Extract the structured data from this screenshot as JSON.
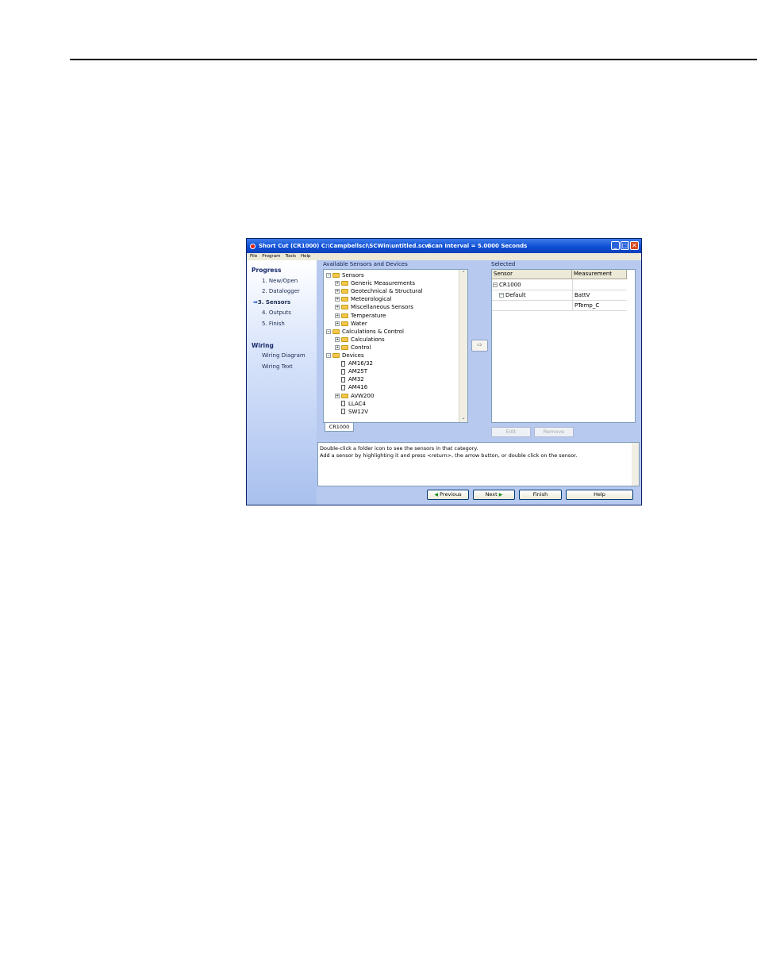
{
  "window": {
    "title": "Short Cut (CR1000) C:\\Campbellsci\\SCWin\\untitled.scw",
    "scan_interval": "Scan Interval = 5.0000 Seconds",
    "menu": [
      "File",
      "Program",
      "Tools",
      "Help"
    ]
  },
  "sidebar": {
    "progress_heading": "Progress",
    "steps": [
      "1. New/Open",
      "2. Datalogger",
      "3. Sensors",
      "4. Outputs",
      "5. Finish"
    ],
    "active_step": "3. Sensors",
    "wiring_heading": "Wiring",
    "wiring_items": [
      "Wiring Diagram",
      "Wiring Text"
    ]
  },
  "available": {
    "label": "Available Sensors and Devices",
    "tree": [
      {
        "label": "Sensors",
        "depth": 0,
        "kind": "folder",
        "expanded": true
      },
      {
        "label": "Generic Measurements",
        "depth": 1,
        "kind": "folder",
        "expanded": false
      },
      {
        "label": "Geotechnical & Structural",
        "depth": 1,
        "kind": "folder",
        "expanded": false
      },
      {
        "label": "Meteorological",
        "depth": 1,
        "kind": "folder",
        "expanded": false
      },
      {
        "label": "Miscellaneous Sensors",
        "depth": 1,
        "kind": "folder",
        "expanded": false
      },
      {
        "label": "Temperature",
        "depth": 1,
        "kind": "folder",
        "expanded": false
      },
      {
        "label": "Water",
        "depth": 1,
        "kind": "folder",
        "expanded": false
      },
      {
        "label": "Calculations & Control",
        "depth": 0,
        "kind": "folder",
        "expanded": true
      },
      {
        "label": "Calculations",
        "depth": 1,
        "kind": "folder",
        "expanded": false
      },
      {
        "label": "Control",
        "depth": 1,
        "kind": "folder",
        "expanded": false
      },
      {
        "label": "Devices",
        "depth": 0,
        "kind": "folder",
        "expanded": true
      },
      {
        "label": "AM16/32",
        "depth": 1,
        "kind": "doc"
      },
      {
        "label": "AM25T",
        "depth": 1,
        "kind": "doc"
      },
      {
        "label": "AM32",
        "depth": 1,
        "kind": "doc"
      },
      {
        "label": "AM416",
        "depth": 1,
        "kind": "doc"
      },
      {
        "label": "AVW200",
        "depth": 1,
        "kind": "folder",
        "expanded": false
      },
      {
        "label": "LLAC4",
        "depth": 1,
        "kind": "doc"
      },
      {
        "label": "SW12V",
        "depth": 1,
        "kind": "doc"
      }
    ],
    "tab": "CR1000",
    "add_arrow": "⇨"
  },
  "selected": {
    "label": "Selected",
    "columns": [
      "Sensor",
      "Measurement"
    ],
    "rows": [
      {
        "sensor": "CR1000",
        "measurement": ""
      },
      {
        "sensor": "Default",
        "measurement": "BattV"
      },
      {
        "sensor": "",
        "measurement": "PTemp_C"
      }
    ],
    "edit_label": "Edit",
    "remove_label": "Remove"
  },
  "help_text": [
    "Double-click a folder icon to see the sensors in that category.",
    "Add a sensor by highlighting it and press <return>, the arrow button, or double click on the sensor."
  ],
  "buttons": {
    "previous": "Previous",
    "next": "Next",
    "finish": "Finish",
    "help": "Help"
  }
}
